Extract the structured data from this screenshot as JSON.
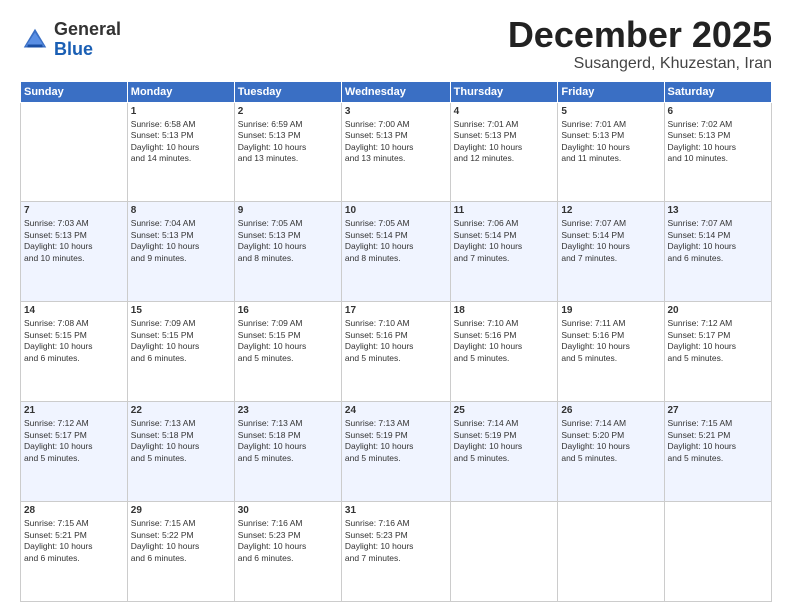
{
  "header": {
    "logo_line1": "General",
    "logo_line2": "Blue",
    "month": "December 2025",
    "location": "Susangerd, Khuzestan, Iran"
  },
  "weekdays": [
    "Sunday",
    "Monday",
    "Tuesday",
    "Wednesday",
    "Thursday",
    "Friday",
    "Saturday"
  ],
  "rows": [
    [
      {
        "day": "",
        "lines": []
      },
      {
        "day": "1",
        "lines": [
          "Sunrise: 6:58 AM",
          "Sunset: 5:13 PM",
          "Daylight: 10 hours",
          "and 14 minutes."
        ]
      },
      {
        "day": "2",
        "lines": [
          "Sunrise: 6:59 AM",
          "Sunset: 5:13 PM",
          "Daylight: 10 hours",
          "and 13 minutes."
        ]
      },
      {
        "day": "3",
        "lines": [
          "Sunrise: 7:00 AM",
          "Sunset: 5:13 PM",
          "Daylight: 10 hours",
          "and 13 minutes."
        ]
      },
      {
        "day": "4",
        "lines": [
          "Sunrise: 7:01 AM",
          "Sunset: 5:13 PM",
          "Daylight: 10 hours",
          "and 12 minutes."
        ]
      },
      {
        "day": "5",
        "lines": [
          "Sunrise: 7:01 AM",
          "Sunset: 5:13 PM",
          "Daylight: 10 hours",
          "and 11 minutes."
        ]
      },
      {
        "day": "6",
        "lines": [
          "Sunrise: 7:02 AM",
          "Sunset: 5:13 PM",
          "Daylight: 10 hours",
          "and 10 minutes."
        ]
      }
    ],
    [
      {
        "day": "7",
        "lines": [
          "Sunrise: 7:03 AM",
          "Sunset: 5:13 PM",
          "Daylight: 10 hours",
          "and 10 minutes."
        ]
      },
      {
        "day": "8",
        "lines": [
          "Sunrise: 7:04 AM",
          "Sunset: 5:13 PM",
          "Daylight: 10 hours",
          "and 9 minutes."
        ]
      },
      {
        "day": "9",
        "lines": [
          "Sunrise: 7:05 AM",
          "Sunset: 5:13 PM",
          "Daylight: 10 hours",
          "and 8 minutes."
        ]
      },
      {
        "day": "10",
        "lines": [
          "Sunrise: 7:05 AM",
          "Sunset: 5:14 PM",
          "Daylight: 10 hours",
          "and 8 minutes."
        ]
      },
      {
        "day": "11",
        "lines": [
          "Sunrise: 7:06 AM",
          "Sunset: 5:14 PM",
          "Daylight: 10 hours",
          "and 7 minutes."
        ]
      },
      {
        "day": "12",
        "lines": [
          "Sunrise: 7:07 AM",
          "Sunset: 5:14 PM",
          "Daylight: 10 hours",
          "and 7 minutes."
        ]
      },
      {
        "day": "13",
        "lines": [
          "Sunrise: 7:07 AM",
          "Sunset: 5:14 PM",
          "Daylight: 10 hours",
          "and 6 minutes."
        ]
      }
    ],
    [
      {
        "day": "14",
        "lines": [
          "Sunrise: 7:08 AM",
          "Sunset: 5:15 PM",
          "Daylight: 10 hours",
          "and 6 minutes."
        ]
      },
      {
        "day": "15",
        "lines": [
          "Sunrise: 7:09 AM",
          "Sunset: 5:15 PM",
          "Daylight: 10 hours",
          "and 6 minutes."
        ]
      },
      {
        "day": "16",
        "lines": [
          "Sunrise: 7:09 AM",
          "Sunset: 5:15 PM",
          "Daylight: 10 hours",
          "and 5 minutes."
        ]
      },
      {
        "day": "17",
        "lines": [
          "Sunrise: 7:10 AM",
          "Sunset: 5:16 PM",
          "Daylight: 10 hours",
          "and 5 minutes."
        ]
      },
      {
        "day": "18",
        "lines": [
          "Sunrise: 7:10 AM",
          "Sunset: 5:16 PM",
          "Daylight: 10 hours",
          "and 5 minutes."
        ]
      },
      {
        "day": "19",
        "lines": [
          "Sunrise: 7:11 AM",
          "Sunset: 5:16 PM",
          "Daylight: 10 hours",
          "and 5 minutes."
        ]
      },
      {
        "day": "20",
        "lines": [
          "Sunrise: 7:12 AM",
          "Sunset: 5:17 PM",
          "Daylight: 10 hours",
          "and 5 minutes."
        ]
      }
    ],
    [
      {
        "day": "21",
        "lines": [
          "Sunrise: 7:12 AM",
          "Sunset: 5:17 PM",
          "Daylight: 10 hours",
          "and 5 minutes."
        ]
      },
      {
        "day": "22",
        "lines": [
          "Sunrise: 7:13 AM",
          "Sunset: 5:18 PM",
          "Daylight: 10 hours",
          "and 5 minutes."
        ]
      },
      {
        "day": "23",
        "lines": [
          "Sunrise: 7:13 AM",
          "Sunset: 5:18 PM",
          "Daylight: 10 hours",
          "and 5 minutes."
        ]
      },
      {
        "day": "24",
        "lines": [
          "Sunrise: 7:13 AM",
          "Sunset: 5:19 PM",
          "Daylight: 10 hours",
          "and 5 minutes."
        ]
      },
      {
        "day": "25",
        "lines": [
          "Sunrise: 7:14 AM",
          "Sunset: 5:19 PM",
          "Daylight: 10 hours",
          "and 5 minutes."
        ]
      },
      {
        "day": "26",
        "lines": [
          "Sunrise: 7:14 AM",
          "Sunset: 5:20 PM",
          "Daylight: 10 hours",
          "and 5 minutes."
        ]
      },
      {
        "day": "27",
        "lines": [
          "Sunrise: 7:15 AM",
          "Sunset: 5:21 PM",
          "Daylight: 10 hours",
          "and 5 minutes."
        ]
      }
    ],
    [
      {
        "day": "28",
        "lines": [
          "Sunrise: 7:15 AM",
          "Sunset: 5:21 PM",
          "Daylight: 10 hours",
          "and 6 minutes."
        ]
      },
      {
        "day": "29",
        "lines": [
          "Sunrise: 7:15 AM",
          "Sunset: 5:22 PM",
          "Daylight: 10 hours",
          "and 6 minutes."
        ]
      },
      {
        "day": "30",
        "lines": [
          "Sunrise: 7:16 AM",
          "Sunset: 5:23 PM",
          "Daylight: 10 hours",
          "and 6 minutes."
        ]
      },
      {
        "day": "31",
        "lines": [
          "Sunrise: 7:16 AM",
          "Sunset: 5:23 PM",
          "Daylight: 10 hours",
          "and 7 minutes."
        ]
      },
      {
        "day": "",
        "lines": []
      },
      {
        "day": "",
        "lines": []
      },
      {
        "day": "",
        "lines": []
      }
    ]
  ]
}
